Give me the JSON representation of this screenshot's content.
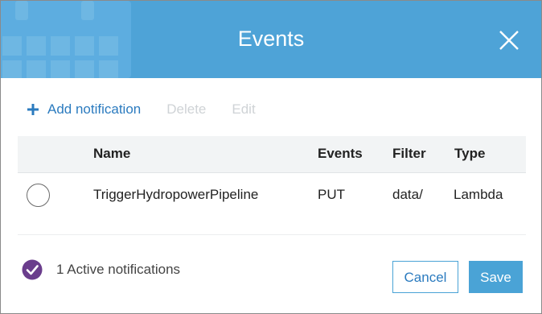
{
  "dialog": {
    "title": "Events",
    "header_icon": "calendar-icon",
    "close_icon": "close-icon",
    "accent_color": "#4ea3d7"
  },
  "toolbar": {
    "add_label": "Add notification",
    "delete_label": "Delete",
    "edit_label": "Edit"
  },
  "table": {
    "columns": [
      "Name",
      "Events",
      "Filter",
      "Type"
    ],
    "rows": [
      {
        "name": "TriggerHydropowerPipeline",
        "events": "PUT",
        "filter": "data/",
        "type": "Lambda"
      }
    ]
  },
  "footer": {
    "status_text": "1 Active notifications",
    "status_color": "#6a3d8c",
    "cancel_label": "Cancel",
    "save_label": "Save"
  }
}
